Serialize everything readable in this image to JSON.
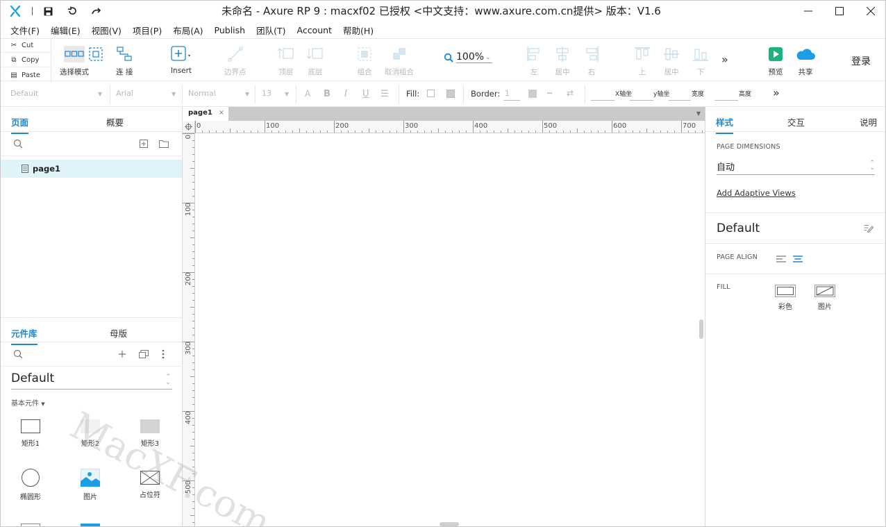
{
  "window": {
    "title": "未命名 - Axure RP 9 : macxf02 已授权    <中文支持：www.axure.com.cn提供> 版本：V1.6"
  },
  "menu": [
    "文件(F)",
    "编辑(E)",
    "视图(V)",
    "项目(P)",
    "布局(A)",
    "Publish",
    "团队(T)",
    "Account",
    "帮助(H)"
  ],
  "clipboard": {
    "cut": "Cut",
    "copy": "Copy",
    "paste": "Paste"
  },
  "toolbar": {
    "select_mode": "选择模式",
    "connect": "连 接",
    "insert": "Insert",
    "boundary": "边界点",
    "top_layer": "顶层",
    "bottom_layer": "底层",
    "group": "组合",
    "ungroup": "取消组合",
    "zoom": "100%",
    "align_left": "左",
    "align_center": "居中",
    "align_right": "右",
    "align_top": "上",
    "align_middle": "居中",
    "align_bottom": "下",
    "preview": "预览",
    "share": "共享",
    "login": "登录"
  },
  "stylebar": {
    "style": "Default",
    "font": "Arial",
    "weight": "Normal",
    "size": "13",
    "fill_label": "Fill:",
    "border_label": "Border:",
    "border_value": "1",
    "x_label": "X轴坐",
    "y_label": "y轴坐",
    "w_label": "宽度",
    "h_label": "高度"
  },
  "left_panel": {
    "tab_pages": "页面",
    "tab_outline": "概要",
    "page_item": "page1",
    "tab_library": "元件库",
    "tab_masters": "母版",
    "library_select": "Default",
    "section": "基本元件",
    "widgets": [
      "矩形1",
      "矩形2",
      "矩形3",
      "椭圆形",
      "图片",
      "占位符"
    ]
  },
  "canvas": {
    "tab": "page1",
    "h_ruler": [
      "0",
      "100",
      "200",
      "300",
      "400",
      "500",
      "600",
      "700"
    ],
    "v_ruler": [
      "0",
      "100",
      "200",
      "300",
      "400",
      "500"
    ],
    "watermark": "MacXF.com"
  },
  "right_panel": {
    "tab_style": "样式",
    "tab_interact": "交互",
    "tab_notes": "说明",
    "page_dimensions_label": "PAGE DIMENSIONS",
    "page_dimensions_value": "自动",
    "adaptive_link": "Add Adaptive Views",
    "style_name": "Default",
    "page_align_label": "PAGE ALIGN",
    "fill_label": "FILL",
    "fill_color": "彩色",
    "fill_image": "图片"
  },
  "colors": {
    "accent": "#1d86d6",
    "logo": "#1aa3e8",
    "preview_green": "#1bb37a",
    "selected_row": "#dff3f8"
  }
}
